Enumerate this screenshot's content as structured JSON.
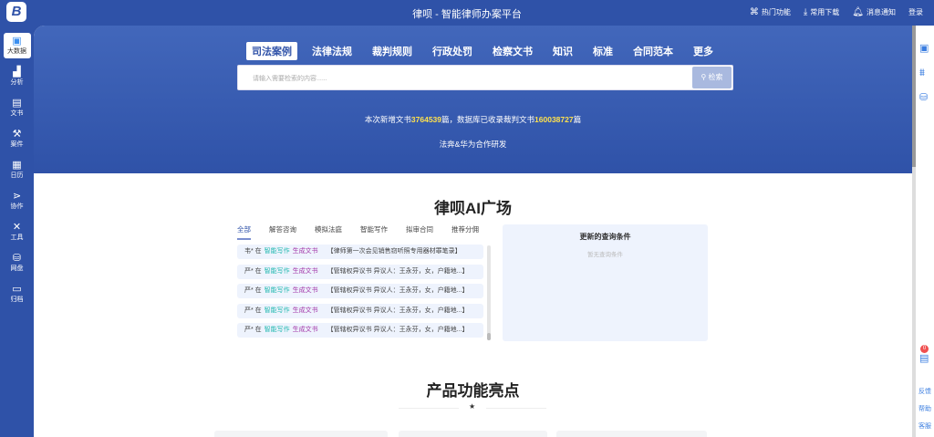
{
  "header": {
    "logo_text": "B",
    "title": "律呗 - 智能律师办案平台",
    "tools": [
      {
        "icon": "grid-icon",
        "label": "热门功能"
      },
      {
        "icon": "download-icon",
        "label": "常用下载"
      },
      {
        "icon": "bell-icon",
        "label": "消息通知"
      }
    ],
    "login": "登录"
  },
  "sidebar": {
    "items": [
      {
        "label": "大数据",
        "icon": "data-icon"
      },
      {
        "label": "分析",
        "icon": "chart-icon"
      },
      {
        "label": "文书",
        "icon": "book-icon"
      },
      {
        "label": "案件",
        "icon": "gavel-icon"
      },
      {
        "label": "日历",
        "icon": "calendar-icon"
      },
      {
        "label": "协作",
        "icon": "share-icon"
      },
      {
        "label": "工具",
        "icon": "tools-icon"
      },
      {
        "label": "网盘",
        "icon": "disk-icon"
      },
      {
        "label": "归档",
        "icon": "archive-icon"
      }
    ]
  },
  "banner": {
    "tabs": [
      "司法案例",
      "法律法规",
      "裁判规则",
      "行政处罚",
      "检察文书",
      "知识",
      "标准",
      "合同范本",
      "更多"
    ],
    "search_placeholder": "请输入需要检索的内容......",
    "search_button": "检索",
    "stats_prefix": "本次新增文书",
    "new_docs": "3764539",
    "stats_mid": "篇，数据库已收录裁判文书",
    "total_docs": "160038727",
    "stats_suffix": "篇",
    "coop": "法奔&华为合作研发"
  },
  "ai": {
    "title": "律呗AI广场",
    "tabs": [
      "全部",
      "解答咨询",
      "模拟法庭",
      "智能写作",
      "拟审合同",
      "推荐分佣"
    ],
    "rows": [
      {
        "user": "韦* 在",
        "module": "智能写作",
        "action": "生成文书",
        "content": "【律师第一次会见销售窃听照专用器材罪笔录】"
      },
      {
        "user": "严* 在",
        "module": "智能写作",
        "action": "生成文书",
        "content": "【管辖权异议书 异议人：王永芬，女，户籍地...】"
      },
      {
        "user": "严* 在",
        "module": "智能写作",
        "action": "生成文书",
        "content": "【管辖权异议书 异议人：王永芬，女，户籍地...】"
      },
      {
        "user": "严* 在",
        "module": "智能写作",
        "action": "生成文书",
        "content": "【管辖权异议书 异议人：王永芬，女，户籍地...】"
      },
      {
        "user": "严* 在",
        "module": "智能写作",
        "action": "生成文书",
        "content": "【管辖权异议书 异议人：王永芬，女，户籍地...】"
      }
    ],
    "query_title": "更新的查询条件",
    "query_empty": "暂无查询条件"
  },
  "features": {
    "title": "产品功能亮点",
    "star": "★"
  },
  "right_panel": {
    "badge": "0",
    "links": [
      "反馈",
      "帮助",
      "客服"
    ]
  }
}
